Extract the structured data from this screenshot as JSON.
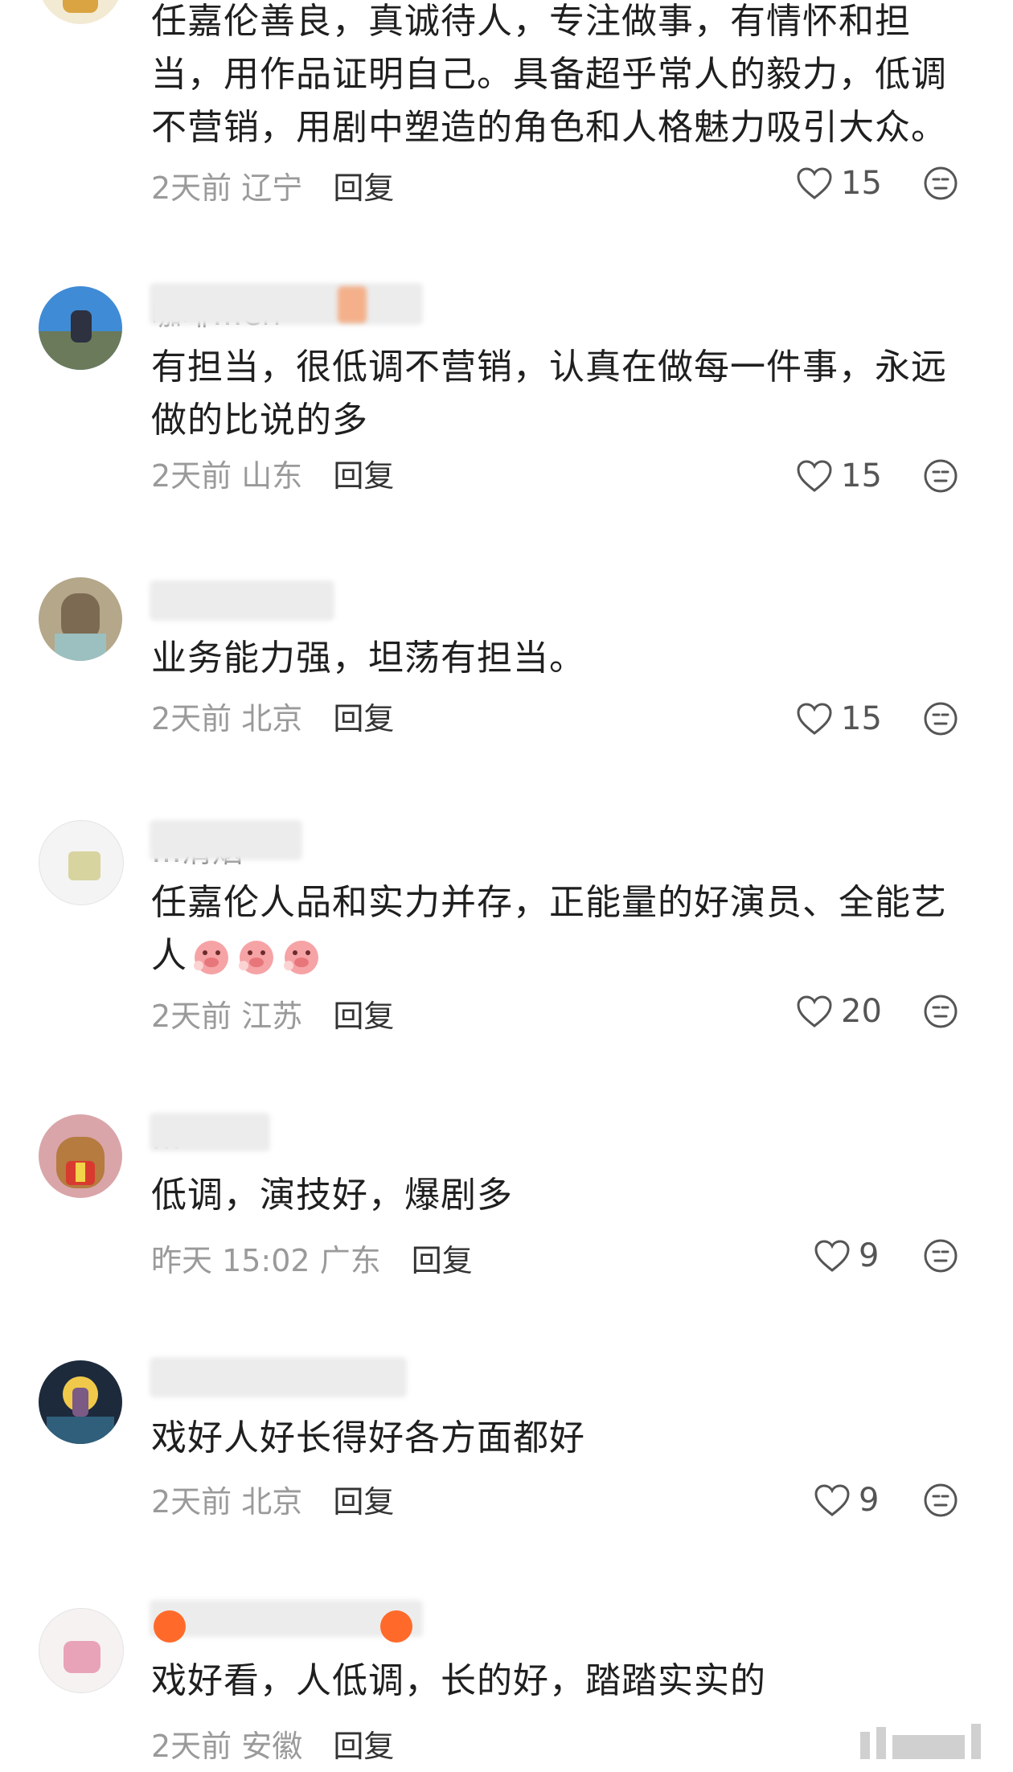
{
  "colors": {
    "accent": "#e86b4a",
    "muted": "#9a9a9a",
    "reply": "#333333"
  },
  "comments": [
    {
      "username": "",
      "text": "任嘉伦善良，真诚待人，专注做事，有情怀和担当，用作品证明自己。具备超乎常人的毅力，低调不营销，用剧中塑造的角色和人格魅力吸引大众。",
      "time": "2天前",
      "location": "辽宁",
      "reply": "回复",
      "likes": "15"
    },
    {
      "username": "咖啡…en",
      "text": "有担当，很低调不营销，认真在做每一件事，永远做的比说的多",
      "time": "2天前",
      "location": "山东",
      "reply": "回复",
      "likes": "15"
    },
    {
      "username": "",
      "text": "业务能力强，坦荡有担当。",
      "time": "2天前",
      "location": "北京",
      "reply": "回复",
      "likes": "15"
    },
    {
      "username": "…清烟",
      "text": "任嘉伦人品和实力并存，正能量的好演员、全能艺人",
      "time": "2天前",
      "location": "江苏",
      "reply": "回复",
      "likes": "20"
    },
    {
      "username": "…",
      "text": "低调，演技好，爆剧多",
      "time": "昨天 15:02",
      "location": "广东",
      "reply": "回复",
      "likes": "9"
    },
    {
      "username": "",
      "text": "戏好人好长得好各方面都好",
      "time": "2天前",
      "location": "北京",
      "reply": "回复",
      "likes": "9"
    },
    {
      "username": "",
      "text": "戏好看，人低调，长的好，踏踏实实的",
      "time": "2天前",
      "location": "安徽",
      "reply": "回复",
      "likes": ""
    }
  ]
}
